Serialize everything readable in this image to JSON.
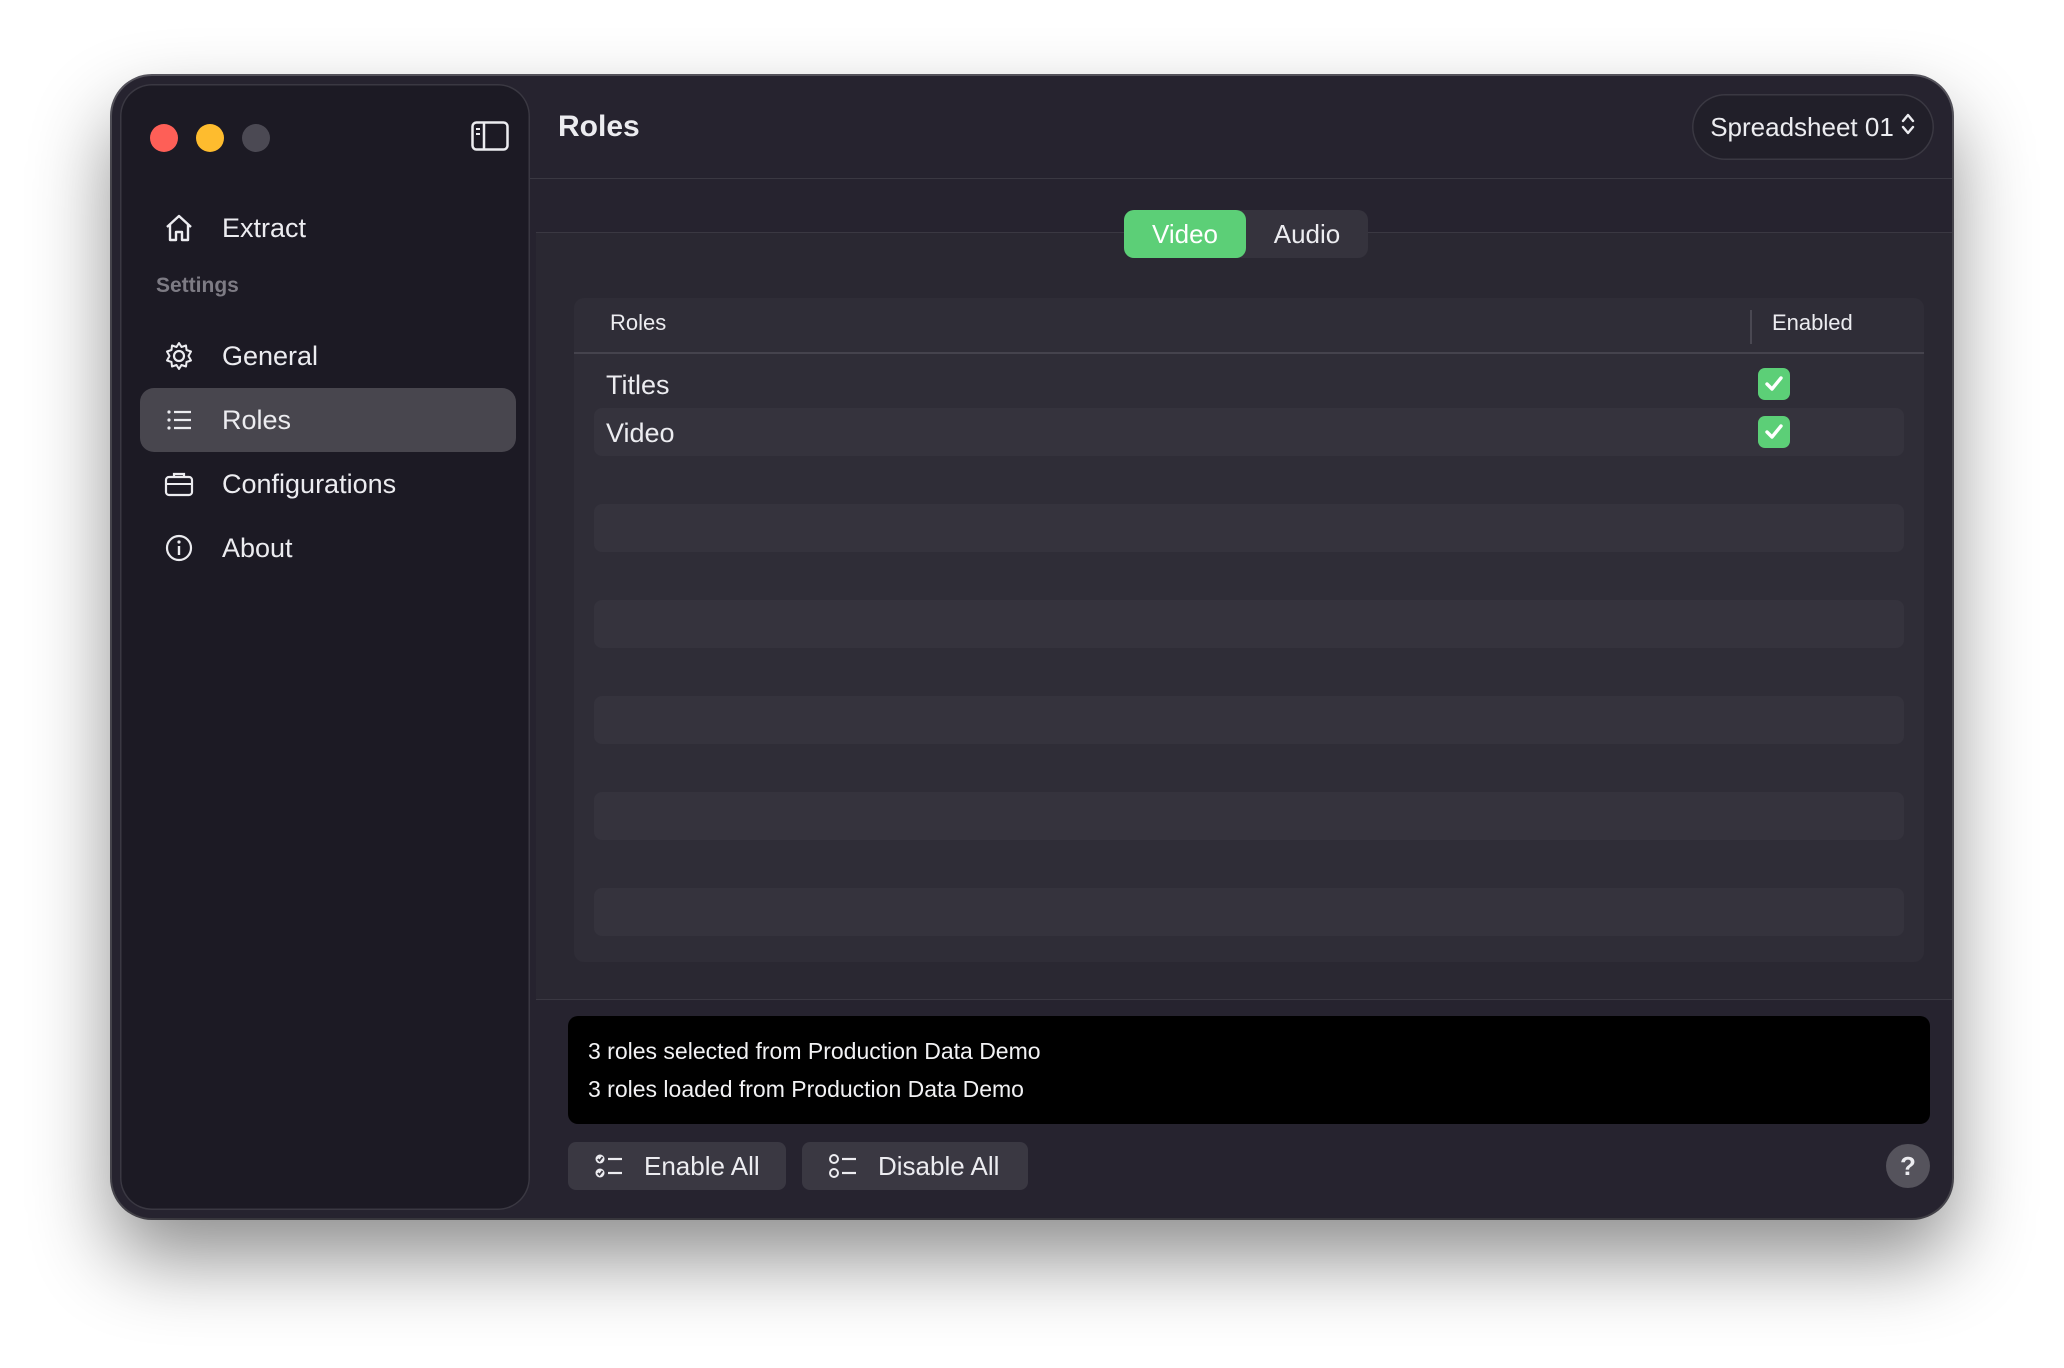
{
  "window": {
    "title": "Roles"
  },
  "sidebar": {
    "section_label": "Settings",
    "items": [
      {
        "label": "Extract",
        "icon": "house-icon"
      },
      {
        "label": "General",
        "icon": "gear-icon"
      },
      {
        "label": "Roles",
        "icon": "list-icon",
        "active": true
      },
      {
        "label": "Configurations",
        "icon": "briefcase-icon"
      },
      {
        "label": "About",
        "icon": "info-circle-icon"
      }
    ]
  },
  "header": {
    "title": "Roles",
    "document_selector": "Spreadsheet 01"
  },
  "segmented": {
    "options": [
      "Video",
      "Audio"
    ],
    "selected": "Video"
  },
  "table": {
    "columns": [
      "Roles",
      "Enabled"
    ],
    "rows": [
      {
        "name": "Titles",
        "enabled": true
      },
      {
        "name": "Video",
        "enabled": true
      }
    ]
  },
  "log": {
    "lines": [
      "3 roles selected from Production Data Demo",
      "3 roles loaded from Production Data Demo"
    ]
  },
  "footer": {
    "enable_all": "Enable All",
    "disable_all": "Disable All",
    "help": "?"
  },
  "colors": {
    "accent": "#5ccf77",
    "background": "#26232f",
    "sidebar": "#1c1a24"
  }
}
